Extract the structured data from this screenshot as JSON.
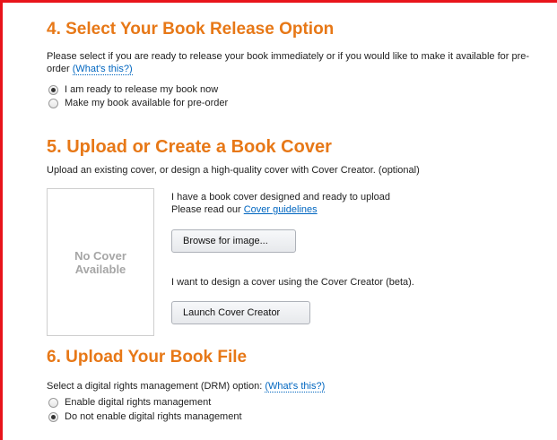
{
  "section4": {
    "heading": "4. Select Your Book Release Option",
    "description": "Please select if you are ready to release your book immediately or if you would like to make it available for pre-order",
    "help_link": "(What's this?)",
    "options": [
      {
        "label": "I am ready to release my book now",
        "checked": true
      },
      {
        "label": "Make my book available for pre-order",
        "checked": false
      }
    ]
  },
  "section5": {
    "heading": "5. Upload or Create a Book Cover",
    "description": "Upload an existing cover, or design a high-quality cover with Cover Creator. (optional)",
    "cover_placeholder": "No Cover Available",
    "upload_text": "I have a book cover designed and ready to upload",
    "guidelines_prefix": "Please read our",
    "guidelines_link": "Cover guidelines",
    "browse_button": "Browse for image...",
    "creator_text": "I want to design a cover using the Cover Creator (beta).",
    "creator_button": "Launch Cover Creator"
  },
  "section6": {
    "heading": "6. Upload Your Book File",
    "description": "Select a digital rights management (DRM) option:",
    "help_link": "(What's this?)",
    "options": [
      {
        "label": "Enable digital rights management",
        "checked": false
      },
      {
        "label": "Do not enable digital rights management",
        "checked": true
      }
    ]
  },
  "colors": {
    "heading": "#e77817",
    "link": "#0066c0",
    "frame": "#e8141b"
  }
}
